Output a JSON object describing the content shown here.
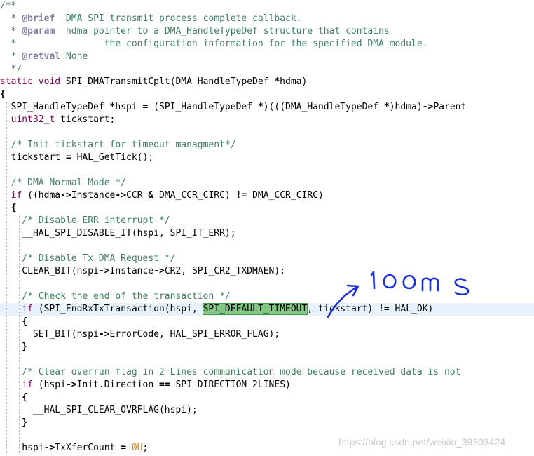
{
  "lines": [
    [
      {
        "t": "/**",
        "c": "comment"
      }
    ],
    [
      {
        "t": "  * ",
        "c": "comment"
      },
      {
        "t": "@brief",
        "c": "doctag"
      },
      {
        "t": "  DMA SPI transmit process complete callback.",
        "c": "comment"
      }
    ],
    [
      {
        "t": "  * ",
        "c": "comment"
      },
      {
        "t": "@param",
        "c": "doctag"
      },
      {
        "t": "  hdma pointer to a DMA_HandleTypeDef structure that contains",
        "c": "comment"
      }
    ],
    [
      {
        "t": "  *                the configuration information for the specified DMA module.",
        "c": "comment"
      }
    ],
    [
      {
        "t": "  * ",
        "c": "comment"
      },
      {
        "t": "@retval",
        "c": "doctag"
      },
      {
        "t": " None",
        "c": "comment"
      }
    ],
    [
      {
        "t": "  */",
        "c": "comment"
      }
    ],
    [
      {
        "t": "static void",
        "c": "keyword"
      },
      {
        "t": " SPI_DMATransmitCplt(DMA_HandleTypeDef ",
        "c": "plain"
      },
      {
        "t": "*",
        "c": "op"
      },
      {
        "t": "hdma)",
        "c": "plain"
      }
    ],
    [
      {
        "t": "{",
        "c": "bold"
      }
    ],
    [
      {
        "t": "  SPI_HandleTypeDef ",
        "c": "plain"
      },
      {
        "t": "*",
        "c": "op"
      },
      {
        "t": "hspi ",
        "c": "plain"
      },
      {
        "t": "=",
        "c": "op"
      },
      {
        "t": " (SPI_HandleTypeDef ",
        "c": "plain"
      },
      {
        "t": "*",
        "c": "op"
      },
      {
        "t": ")(((DMA_HandleTypeDef ",
        "c": "plain"
      },
      {
        "t": "*",
        "c": "op"
      },
      {
        "t": ")hdma)",
        "c": "plain"
      },
      {
        "t": "->",
        "c": "op"
      },
      {
        "t": "Parent",
        "c": "plain"
      }
    ],
    [
      {
        "t": "  ",
        "c": "plain"
      },
      {
        "t": "uint32_t",
        "c": "type"
      },
      {
        "t": " tickstart;",
        "c": "plain"
      }
    ],
    [],
    [
      {
        "t": "  /* Init tickstart for timeout managment*/",
        "c": "comment"
      }
    ],
    [
      {
        "t": "  tickstart ",
        "c": "plain"
      },
      {
        "t": "=",
        "c": "op"
      },
      {
        "t": " HAL_GetTick();",
        "c": "plain"
      }
    ],
    [],
    [
      {
        "t": "  /* DMA Normal Mode */",
        "c": "comment"
      }
    ],
    [
      {
        "t": "  ",
        "c": "plain"
      },
      {
        "t": "if",
        "c": "keyword"
      },
      {
        "t": " ((hdma",
        "c": "plain"
      },
      {
        "t": "->",
        "c": "op"
      },
      {
        "t": "Instance",
        "c": "plain"
      },
      {
        "t": "->",
        "c": "op"
      },
      {
        "t": "CCR ",
        "c": "plain"
      },
      {
        "t": "&",
        "c": "op"
      },
      {
        "t": " DMA_CCR_CIRC) ",
        "c": "plain"
      },
      {
        "t": "!=",
        "c": "op"
      },
      {
        "t": " DMA_CCR_CIRC)",
        "c": "plain"
      }
    ],
    [
      {
        "t": "  {",
        "c": "bold"
      }
    ],
    [
      {
        "t": "    /* Disable ERR interrupt */",
        "c": "comment"
      }
    ],
    [
      {
        "t": "    __HAL_SPI_DISABLE_IT(hspi, SPI_IT_ERR);",
        "c": "plain"
      }
    ],
    [],
    [
      {
        "t": "    /* Disable Tx DMA Request */",
        "c": "comment"
      }
    ],
    [
      {
        "t": "    CLEAR_BIT(hspi",
        "c": "plain"
      },
      {
        "t": "->",
        "c": "op"
      },
      {
        "t": "Instance",
        "c": "plain"
      },
      {
        "t": "->",
        "c": "op"
      },
      {
        "t": "CR2, SPI_CR2_TXDMAEN);",
        "c": "plain"
      }
    ],
    [],
    [
      {
        "t": "    /* Check the end of the transaction */",
        "c": "comment"
      }
    ],
    [
      {
        "t": "    ",
        "c": "plain"
      },
      {
        "t": "if",
        "c": "keyword"
      },
      {
        "t": " (SPI_EndRxTxTransaction(hspi, ",
        "c": "plain"
      },
      {
        "t": "SPI_DEFAULT_TIMEOUT",
        "c": "selected"
      },
      {
        "t": ", tickstart) ",
        "c": "plain"
      },
      {
        "t": "!=",
        "c": "op"
      },
      {
        "t": " HAL_OK)",
        "c": "plain"
      }
    ],
    [
      {
        "t": "    {",
        "c": "bold"
      }
    ],
    [
      {
        "t": "      SET_BIT(hspi",
        "c": "plain"
      },
      {
        "t": "->",
        "c": "op"
      },
      {
        "t": "ErrorCode, HAL_SPI_ERROR_FLAG);",
        "c": "plain"
      }
    ],
    [
      {
        "t": "    }",
        "c": "bold"
      }
    ],
    [],
    [
      {
        "t": "    /* Clear overrun flag in 2 Lines communication mode because received data is not",
        "c": "comment"
      }
    ],
    [
      {
        "t": "    ",
        "c": "plain"
      },
      {
        "t": "if",
        "c": "keyword"
      },
      {
        "t": " (hspi",
        "c": "plain"
      },
      {
        "t": "->",
        "c": "op"
      },
      {
        "t": "Init.Direction ",
        "c": "plain"
      },
      {
        "t": "==",
        "c": "op"
      },
      {
        "t": " SPI_DIRECTION_2LINES)",
        "c": "plain"
      }
    ],
    [
      {
        "t": "    {",
        "c": "bold"
      }
    ],
    [
      {
        "t": "      __HAL_SPI_CLEAR_OVRFLAG(hspi);",
        "c": "plain"
      }
    ],
    [
      {
        "t": "    }",
        "c": "bold"
      }
    ],
    [],
    [
      {
        "t": "    hspi",
        "c": "plain"
      },
      {
        "t": "->",
        "c": "op"
      },
      {
        "t": "TxXferCount ",
        "c": "plain"
      },
      {
        "t": "=",
        "c": "op"
      },
      {
        "t": " ",
        "c": "plain"
      },
      {
        "t": "0U",
        "c": "number"
      },
      {
        "t": ";",
        "c": "plain"
      }
    ]
  ],
  "highlighted_line": 24,
  "annotation": {
    "text": "100ms",
    "color": "#1b2fd6"
  },
  "watermark": "https://blog.csdn.net/weixin_39303424",
  "colors": {
    "comment": "#3f7f5f",
    "keyword": "#7f0055",
    "number": "#e37e00",
    "selection": "#80c883",
    "current_line": "#e8f2fe"
  }
}
